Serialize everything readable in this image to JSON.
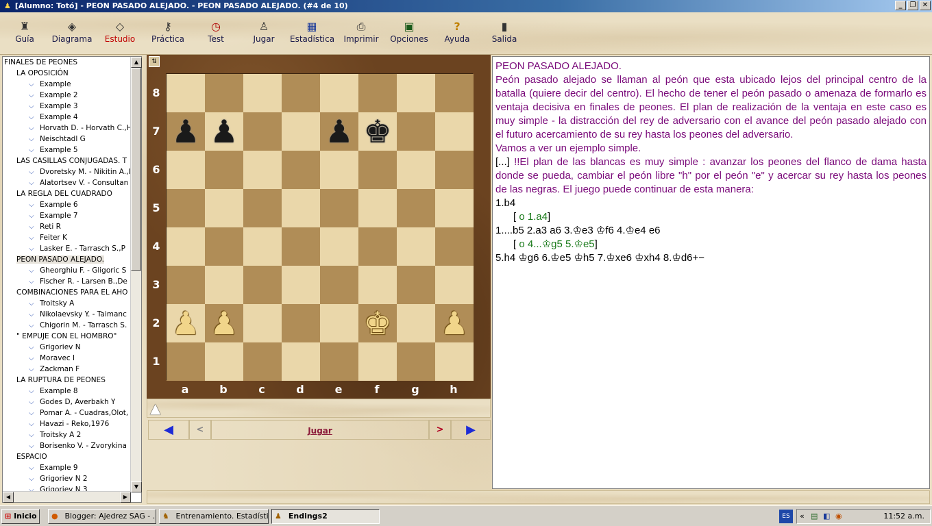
{
  "window": {
    "title": "[Alumno: Totó]  - PEON PASADO ALEJADO.  - PEON PASADO ALEJADO. (#4 de 10)"
  },
  "toolbar": {
    "items": [
      {
        "label": "Guía",
        "icon": "guide-icon"
      },
      {
        "label": "Diagrama",
        "icon": "diagram-icon"
      },
      {
        "label": "Estudio",
        "icon": "study-icon"
      },
      {
        "label": "Práctica",
        "icon": "key-icon"
      },
      {
        "label": "Test",
        "icon": "clock-icon"
      },
      {
        "label": "Jugar",
        "icon": "pawn-icon"
      },
      {
        "label": "Estadística",
        "icon": "table-icon"
      },
      {
        "label": "Imprimir",
        "icon": "printer-icon"
      },
      {
        "label": "Opciones",
        "icon": "monitor-icon"
      },
      {
        "label": "Ayuda",
        "icon": "help-icon"
      },
      {
        "label": "Salida",
        "icon": "exit-door-icon"
      }
    ],
    "active": "Estudio",
    "active_color": "#c00000"
  },
  "tree": {
    "nodes": [
      {
        "text": "FINALES DE PEONES",
        "level": 0
      },
      {
        "text": "LA OPOSICIÓN",
        "level": 1
      },
      {
        "text": "Example",
        "level": 2
      },
      {
        "text": "Example 2",
        "level": 2
      },
      {
        "text": "Example 3",
        "level": 2
      },
      {
        "text": "Example 4",
        "level": 2
      },
      {
        "text": "Horvath D. - Horvath C.,H",
        "level": 2
      },
      {
        "text": "Neischtadl G",
        "level": 2
      },
      {
        "text": "Example 5",
        "level": 2
      },
      {
        "text": "LAS CASILLAS CONJUGADAS. T",
        "level": 1
      },
      {
        "text": "Dvoretsky M. - Nikitin A.,I",
        "level": 2
      },
      {
        "text": "Alatortsev V. - Consultan",
        "level": 2
      },
      {
        "text": "LA REGLA DEL CUADRADO",
        "level": 1
      },
      {
        "text": "Example 6",
        "level": 2
      },
      {
        "text": "Example 7",
        "level": 2
      },
      {
        "text": "Reti R",
        "level": 2
      },
      {
        "text": "Feiter K",
        "level": 2
      },
      {
        "text": "Lasker E. - Tarrasch S.,P",
        "level": 2
      },
      {
        "text": "PEON PASADO ALEJADO.",
        "level": 1,
        "selected": true
      },
      {
        "text": "Gheorghiu F. - Gligoric S",
        "level": 2
      },
      {
        "text": "Fischer R. - Larsen B.,De",
        "level": 2
      },
      {
        "text": "COMBINACIONES PARA EL AHO",
        "level": 1
      },
      {
        "text": "Troitsky A",
        "level": 2
      },
      {
        "text": "Nikolaevsky Y. - Taimanc",
        "level": 2
      },
      {
        "text": "Chigorin M. - Tarrasch S.",
        "level": 2
      },
      {
        "text": "\" EMPUJE CON EL HOMBRO\"",
        "level": 1
      },
      {
        "text": "Grigoriev N",
        "level": 2
      },
      {
        "text": "Moravec I",
        "level": 2
      },
      {
        "text": "Zackman F",
        "level": 2
      },
      {
        "text": "LA  RUPTURA DE PEONES",
        "level": 1
      },
      {
        "text": "Example 8",
        "level": 2
      },
      {
        "text": "Godes D, Averbakh Y",
        "level": 2
      },
      {
        "text": "Pomar A. - Cuadras,Olot,",
        "level": 2
      },
      {
        "text": "Havazi - Reko,1976",
        "level": 2
      },
      {
        "text": "Troitsky A 2",
        "level": 2
      },
      {
        "text": "Borisenko V. - Zvorykina",
        "level": 2
      },
      {
        "text": "ESPACIO",
        "level": 1
      },
      {
        "text": "Example 9",
        "level": 2
      },
      {
        "text": "Grigoriev N 2",
        "level": 2
      },
      {
        "text": "Grigoriev N 3",
        "level": 2
      }
    ],
    "scroll_fraction": 0.0
  },
  "board": {
    "ranks": [
      "8",
      "7",
      "6",
      "5",
      "4",
      "3",
      "2",
      "1"
    ],
    "files": [
      "a",
      "b",
      "c",
      "d",
      "e",
      "f",
      "g",
      "h"
    ],
    "position": [
      [
        "",
        "",
        "",
        "",
        "",
        "",
        "",
        ""
      ],
      [
        "bP",
        "bP",
        "",
        "",
        "bP",
        "bK",
        "",
        ""
      ],
      [
        "",
        "",
        "",
        "",
        "",
        "",
        "",
        ""
      ],
      [
        "",
        "",
        "",
        "",
        "",
        "",
        "",
        ""
      ],
      [
        "",
        "",
        "",
        "",
        "",
        "",
        "",
        ""
      ],
      [
        "",
        "",
        "",
        "",
        "",
        "",
        "",
        ""
      ],
      [
        "wP",
        "wP",
        "",
        "",
        "",
        "wK",
        "",
        "wP"
      ],
      [
        "",
        "",
        "",
        "",
        "",
        "",
        "",
        ""
      ]
    ],
    "light_color": "#ead7aa",
    "dark_color": "#b08d57",
    "side_to_move": "white"
  },
  "nav": {
    "first_label": "◀",
    "prev_label": "<",
    "play_label": "Jugar",
    "next_label": ">",
    "last_label": "▶"
  },
  "notes": {
    "title": "PEON PASADO ALEJADO.",
    "paragraph1": "Peón pasado alejado se llaman al peón que esta ubicado lejos del principal centro de la batalla (quiere decir del centro). El hecho de tener el peón pasado  o amenaza de formarlo es ventaja decisiva en finales de peones. El plan  de realización de la ventaja en este caso es muy simple - la distracción del rey de adversario con el avance del peón pasado alejado con el futuro acercamiento  de su rey hasta los peones del adversario.",
    "paragraph2": "Vamos a ver un ejemplo simple.",
    "ellipsis": "[...]",
    "paragraph3": " !!El plan de las blancas es muy simple : avanzar los peones del flanco  de dama hasta donde se pueda, cambiar el peón libre \"h\" por el peón \"e\" y   acercar su rey hasta los peones de las negras. El juego puede continuar de esta  manera:",
    "move1": "1.b4",
    "var1_open": "[",
    "var1": " o 1.a4",
    "var1_close": "]",
    "move2": "1....b5 2.a3 a6 3.♔e3 ♔f6 4.♔e4 e6",
    "var2_open": "[",
    "var2": " o 4...♔g5 5.♔e5",
    "var2_close": "]",
    "move3": "5.h4 ♔g6 6.♔e5 ♔h5 7.♔xe6 ♔xh4 8.♔d6+−",
    "colors": {
      "text": "#7a0a7a",
      "variation": "#1a7a1a",
      "moves": "#000000"
    }
  },
  "taskbar": {
    "start_label": "Inicio",
    "tasks": [
      {
        "label": "Blogger: Ajedrez SAG - ...",
        "icon": "firefox-icon"
      },
      {
        "label": "Entrenamiento. Estadísti...",
        "icon": "app-icon"
      },
      {
        "label": "Endings2",
        "icon": "pawn-icon",
        "pressed": true
      }
    ],
    "language": "ES",
    "clock": "11:52 a.m."
  }
}
